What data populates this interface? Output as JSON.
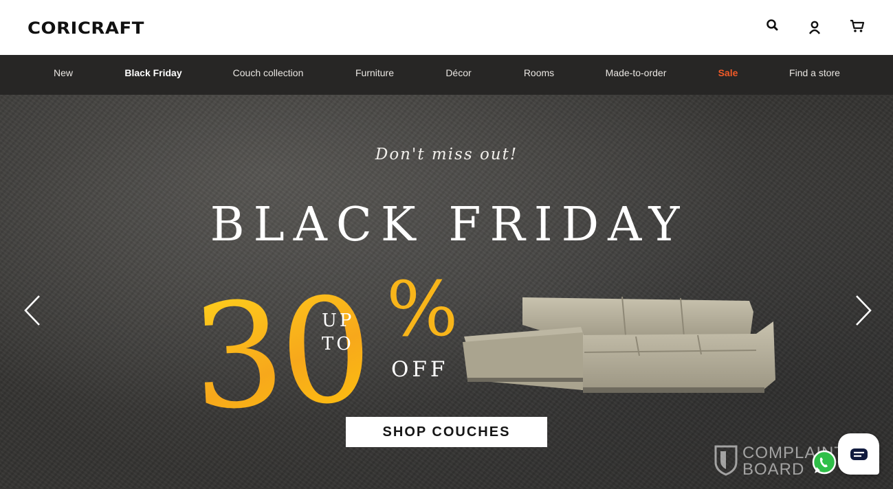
{
  "header": {
    "logo": "CORICRAFT",
    "icons": [
      "search-icon",
      "account-icon",
      "cart-icon"
    ]
  },
  "nav": {
    "items": [
      {
        "label": "New"
      },
      {
        "label": "Black Friday"
      },
      {
        "label": "Couch collection"
      },
      {
        "label": "Furniture"
      },
      {
        "label": "Décor"
      },
      {
        "label": "Rooms"
      },
      {
        "label": "Made-to-order"
      },
      {
        "label": "Sale",
        "color": "#f05a28"
      },
      {
        "label": "Find a store"
      }
    ]
  },
  "hero": {
    "tagline": "Don't miss out!",
    "headline": "BLACK FRIDAY",
    "discount_number": "30",
    "percent_sign": "%",
    "up": "UP",
    "to": "TO",
    "off": "OFF",
    "cta": "SHOP COUCHES",
    "accent_color": "#f8b51a"
  },
  "overlay": {
    "watermark_line1": "COMPLAINTS",
    "watermark_line2": "BOARD"
  }
}
